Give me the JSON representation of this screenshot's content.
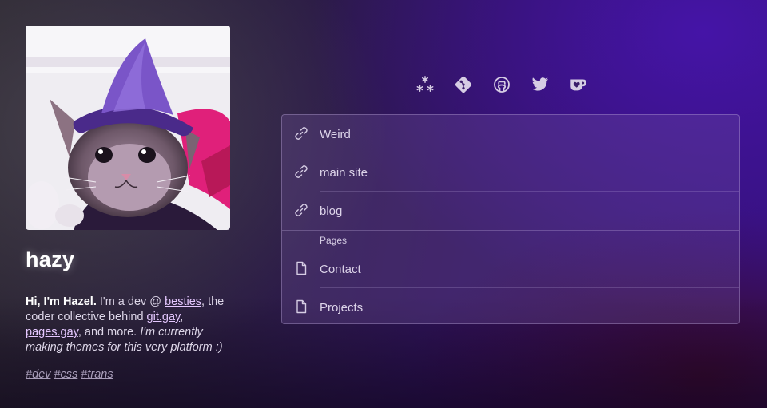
{
  "profile": {
    "name": "hazy",
    "bio": {
      "intro": "Hi, I'm Hazel.",
      "text1": " I'm a dev @ ",
      "link1": "besties",
      "text2": ", the coder collective behind ",
      "link2": "git.gay",
      "text3": ", ",
      "link3": "pages.gay",
      "text4": ", and more. ",
      "italic": "I'm currently making themes for this very platform :)"
    },
    "tags": [
      "#dev",
      "#css",
      "#trans"
    ]
  },
  "socials": [
    {
      "icon": "sparkle-icon"
    },
    {
      "icon": "git-icon"
    },
    {
      "icon": "github-icon"
    },
    {
      "icon": "twitter-icon"
    },
    {
      "icon": "kofi-icon"
    }
  ],
  "links": {
    "items": [
      {
        "label": "Weird",
        "icon": "link-icon"
      },
      {
        "label": "main site",
        "icon": "link-icon"
      },
      {
        "label": "blog",
        "icon": "link-icon"
      }
    ],
    "section_title": "Pages",
    "pages": [
      {
        "label": "Contact",
        "icon": "page-icon"
      },
      {
        "label": "Projects",
        "icon": "page-icon"
      }
    ]
  },
  "colors": {
    "accent_link": "#e5c8ff",
    "tag_color": "#a89db9",
    "icon_color": "#d6cde4"
  }
}
